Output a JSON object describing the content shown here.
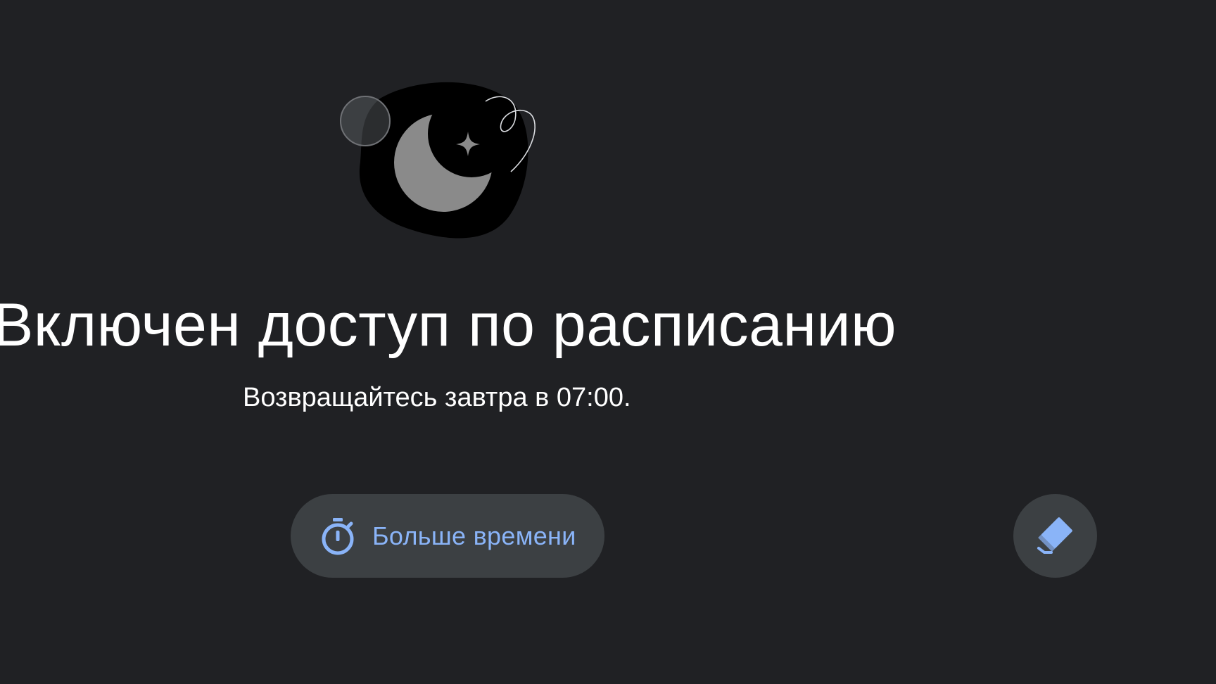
{
  "screen": {
    "title": "Включен доступ по расписанию",
    "subtitle": "Возвращайтесь завтра в 07:00."
  },
  "actions": {
    "more_time_label": "Больше времени",
    "more_time_icon": "timer-icon",
    "fab_icon": "eraser-icon"
  },
  "illustration": {
    "icon": "moon-sleep-illustration"
  },
  "colors": {
    "background": "#202124",
    "button_background": "#3c4043",
    "accent": "#8ab4f8",
    "text": "#ffffff"
  }
}
